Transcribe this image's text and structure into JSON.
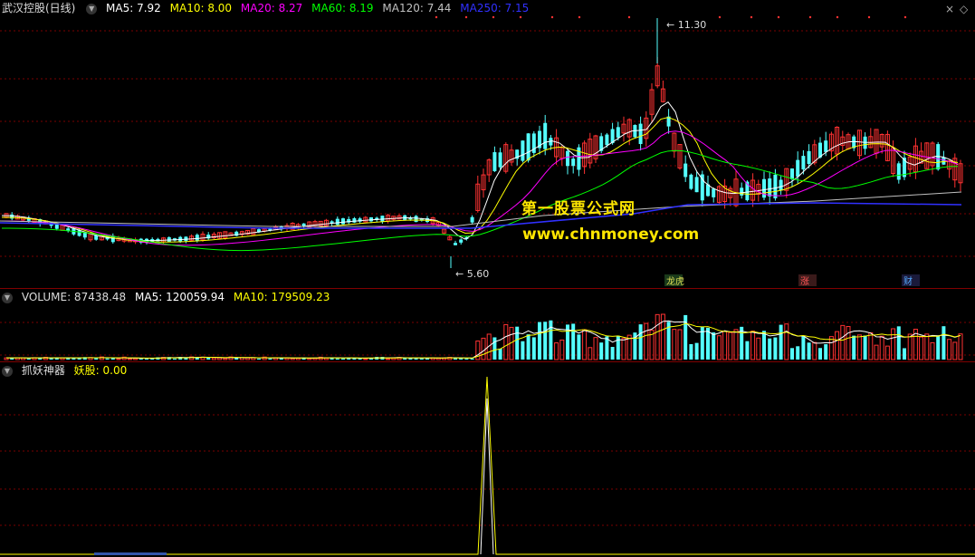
{
  "main_header": {
    "title": "武汉控股(日线)",
    "ma5": "MA5: 7.92",
    "ma10": "MA10: 8.00",
    "ma20": "MA20: 8.27",
    "ma60": "MA60: 8.19",
    "ma120": "MA120: 7.44",
    "ma250": "MA250: 7.15"
  },
  "volume_header": {
    "volume": "VOLUME: 87438.48",
    "ma5": "MA5: 120059.94",
    "ma10": "MA10: 179509.23"
  },
  "indicator_header": {
    "name": "抓妖神器",
    "value": "妖股: 0.00"
  },
  "annotations": {
    "high": "11.30",
    "low": "5.60"
  },
  "markers": {
    "m1": "龙虎",
    "m2": "涨",
    "m3": "财"
  },
  "watermark": {
    "line1": "第一股票公式网",
    "line2": "www.chnmoney.com"
  },
  "colors": {
    "up": "#ff3232",
    "down": "#54ffff",
    "ma5": "#ffffff",
    "ma10": "#ffff00",
    "ma20": "#ff00ff",
    "ma60": "#00ff00",
    "ma120": "#c0c0c0",
    "ma250": "#3030ff"
  }
}
